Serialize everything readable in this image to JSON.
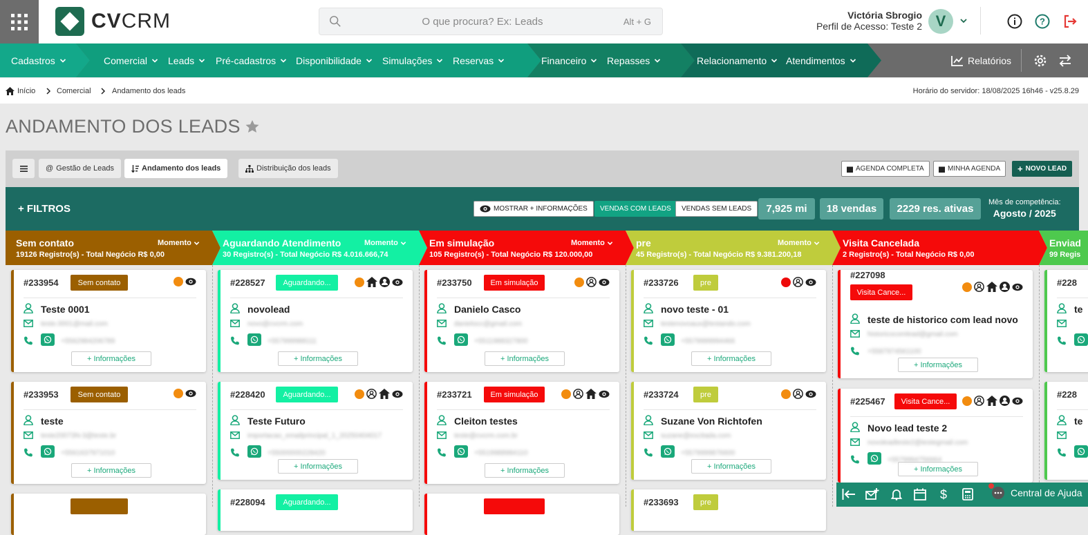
{
  "brand": {
    "name_bold": "CV",
    "name_rest": "CRM",
    "color": "#1e6b50"
  },
  "search": {
    "placeholder": "O que procura? Ex: Leads",
    "shortcut": "Alt + G"
  },
  "user": {
    "name": "Victória Sbrogio",
    "profile": "Perfil de Acesso: Teste 2",
    "initial": "V"
  },
  "nav": [
    {
      "label": "Cadastros"
    },
    {
      "label": "Comercial"
    },
    {
      "label": "Leads"
    },
    {
      "label": "Pré-cadastros"
    },
    {
      "label": "Disponibilidade"
    },
    {
      "label": "Simulações"
    },
    {
      "label": "Reservas"
    },
    {
      "label": "Financeiro"
    },
    {
      "label": "Repasses"
    },
    {
      "label": "Relacionamento"
    },
    {
      "label": "Atendimentos"
    },
    {
      "label": "Relatórios"
    }
  ],
  "breadcrumb": [
    "Início",
    "Comercial",
    "Andamento dos leads"
  ],
  "server_time": "Horário do servidor: 18/08/2025 16h46 - v25.8.29",
  "page_title": "ANDAMENTO DOS LEADS",
  "tabs": [
    {
      "label": "Gestão de Leads"
    },
    {
      "label": "Andamento dos leads"
    },
    {
      "label": "Distribuição dos leads"
    }
  ],
  "actions": {
    "agenda_completa": "AGENDA COMPLETA",
    "minha_agenda": "MINHA AGENDA",
    "novo_lead": "NOVO LEAD"
  },
  "filters": {
    "title": "+ FILTROS",
    "mostrar": "MOSTRAR + INFORMAÇÕES",
    "vendas_com": "VENDAS COM LEADS",
    "vendas_sem": "VENDAS SEM LEADS",
    "stats": [
      "7,925 mi",
      "18 vendas",
      "2229 res. ativas"
    ],
    "mes_label": "Mês de competência:",
    "mes_value": "Agosto / 2025"
  },
  "momento_label": "Momento",
  "more_label": "+ Informações",
  "columns": [
    {
      "name": "Sem contato",
      "summary": "19126 Registro(s) - Total Negócio R$ 0,00",
      "color": "#9b5f00",
      "cards": [
        {
          "id": "#233954",
          "badge": "Sem contato",
          "name": "Teste 0001",
          "email": "teste.0001@mail.com",
          "phone": "+5562984206789",
          "icons": [
            "orange-dot",
            "eye-icon"
          ]
        },
        {
          "id": "#233953",
          "badge": "Sem contato",
          "name": "teste",
          "email": "teste20073N-3@teste.br",
          "phone": "+5561637971010",
          "icons": [
            "orange-dot",
            "eye-icon"
          ]
        }
      ]
    },
    {
      "name": "Aguardando Atendimento",
      "summary": "30 Registro(s) - Total Negócio R$ 4.016.666,74",
      "color": "#13f0a3",
      "cards": [
        {
          "id": "#228527",
          "badge": "Aguardando...",
          "name": "novolead",
          "email": "novo@cvcrm.com",
          "phone": "+557999988111",
          "icons": [
            "orange-dot",
            "home-icon",
            "user-icon",
            "eye-icon"
          ]
        },
        {
          "id": "#228420",
          "badge": "Aguardando...",
          "name": "Teste Futuro",
          "email": "importacao_emailprincipal_1_20250404017",
          "phone": "+55000000228420",
          "icons": [
            "orange-dot",
            "user-circle-icon",
            "home-icon",
            "eye-icon"
          ]
        }
      ]
    },
    {
      "name": "Em simulação",
      "summary": "105 Registro(s) - Total Negócio R$ 120.000,00",
      "color": "#f50a0a",
      "cards": [
        {
          "id": "#233750",
          "badge": "Em simulação",
          "name": "Danielo Casco",
          "email": "danielocc@gmail.com",
          "phone": "+5511988327800",
          "icons": [
            "orange-dot",
            "user-circle-icon",
            "eye-icon"
          ]
        },
        {
          "id": "#233721",
          "badge": "Em simulação",
          "name": "Cleiton testes",
          "email": "teste@cvcrm.com.br",
          "phone": "+5519988984110",
          "icons": [
            "orange-dot",
            "user-circle-icon",
            "home-icon",
            "eye-icon"
          ]
        }
      ]
    },
    {
      "name": "pre",
      "summary": "45 Registro(s) - Total Negócio R$ 9.381.200,18",
      "color": "#bfcc3c",
      "cards": [
        {
          "id": "#233726",
          "badge": "pre",
          "name": "novo teste - 01",
          "email": "testenovoaux@testando.com",
          "phone": "+5579999994466",
          "icons": [
            "red-dot",
            "user-circle-icon",
            "eye-icon"
          ]
        },
        {
          "id": "#233724",
          "badge": "pre",
          "name": "Suzane Von Richtofen",
          "email": "suzane@excitada.com",
          "phone": "+5579999876600",
          "icons": [
            "orange-dot",
            "user-circle-icon",
            "eye-icon"
          ]
        }
      ]
    },
    {
      "name": "Visita Cancelada",
      "summary": "2 Registro(s) - Total Negócio R$ 0,00",
      "color": "#f50a0a",
      "cards": [
        {
          "id": "#227098",
          "badge": "Visita Cance...",
          "name": "teste de historico com lead novo",
          "email": "historicocomlead@gmail.com",
          "phone": "+5587974561100",
          "icons": [
            "orange-dot",
            "user-circle-icon",
            "home-icon",
            "user-icon",
            "eye-icon"
          ]
        },
        {
          "id": "#225467",
          "badge": "Visita Cance...",
          "name": "Novo lead teste 2",
          "email": "novoleadteste2@testegmail.com",
          "phone": "+5579994756664",
          "icons": [
            "orange-dot",
            "user-circle-icon",
            "home-icon",
            "user-icon",
            "eye-icon"
          ]
        }
      ]
    },
    {
      "name": "Enviad",
      "summary": "99 Regis",
      "color": "#4ec94e",
      "cards": [
        {
          "id": "#228",
          "badge": "",
          "name": "te",
          "email": "",
          "phone": "",
          "icons": []
        },
        {
          "id": "#228",
          "badge": "",
          "name": "te",
          "email": "",
          "phone": "",
          "icons": []
        }
      ]
    }
  ],
  "third_row_ids": [
    "#228094",
    "#233693"
  ],
  "third_row_badges": [
    "Aguardando...",
    "pre"
  ],
  "help": "Central de Ajuda"
}
